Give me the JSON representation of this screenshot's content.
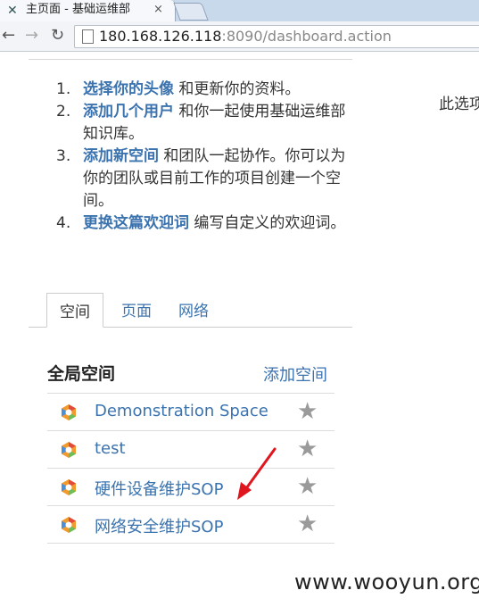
{
  "browser": {
    "tab_title": "主页面 - 基础运维部",
    "tab_close": "×",
    "url_host": "180.168.126.118",
    "url_rest": ":8090/dashboard.action"
  },
  "steps": [
    {
      "num": "1.",
      "link": "选择你的头像",
      "text": " 和更新你的资料。"
    },
    {
      "num": "2.",
      "link": "添加几个用户",
      "text": " 和你一起使用基础运维部知识库。"
    },
    {
      "num": "3.",
      "link": "添加新空间",
      "text": " 和团队一起协作。你可以为你的团队或目前工作的项目创建一个空间。"
    },
    {
      "num": "4.",
      "link": "更换这篇欢迎词",
      "text": " 编写自定义的欢迎词。"
    }
  ],
  "side_text": "此选项",
  "tabs": [
    "空间",
    "页面",
    "网络"
  ],
  "section_title": "全局空间",
  "add_space_label": "添加空间",
  "spaces": [
    {
      "name": "Demonstration Space"
    },
    {
      "name": "test"
    },
    {
      "name": "硬件设备维护SOP"
    },
    {
      "name": "网络安全维护SOP"
    }
  ],
  "icons": {
    "tab_favicon": "confluence-x-icon",
    "space_logo": "space-logo-icon",
    "favorite": "star-icon"
  },
  "colors": {
    "link": "#3b73af",
    "annotation_arrow": "#e0161e"
  },
  "watermark": "www.wooyun.org"
}
